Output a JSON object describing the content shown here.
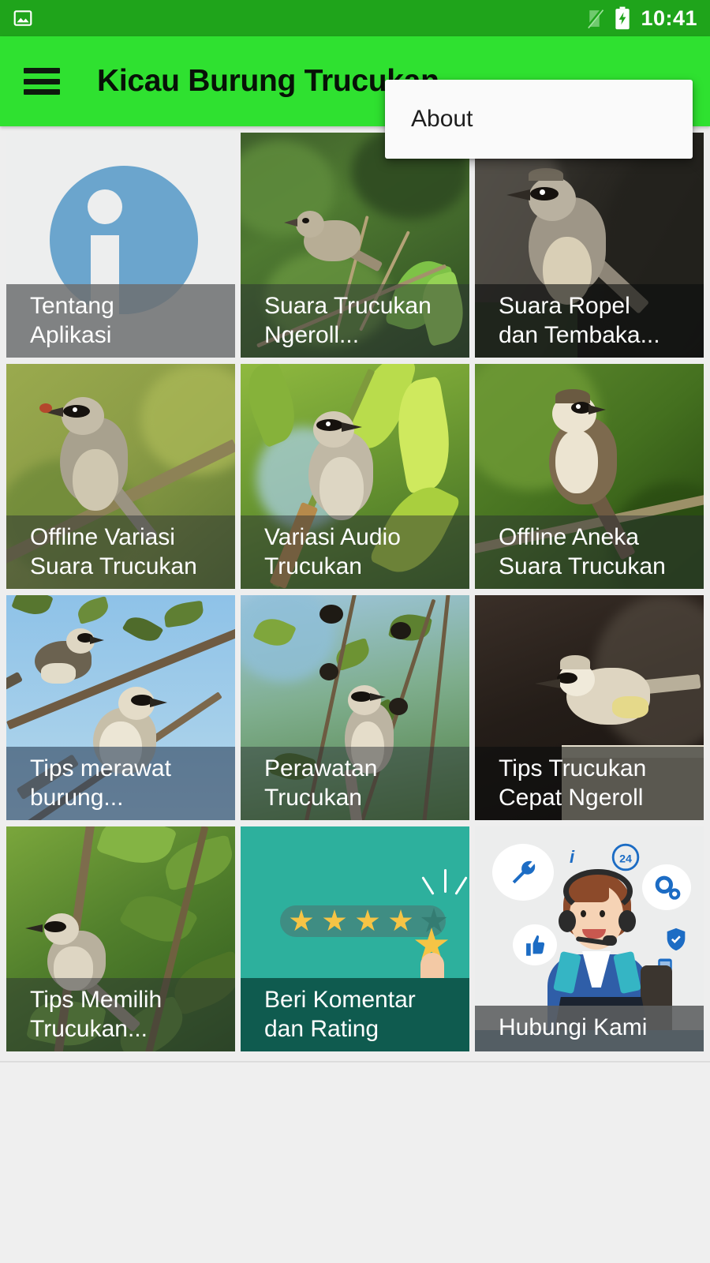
{
  "status_bar": {
    "time": "10:41",
    "icons": [
      "image-icon",
      "signal-off-icon",
      "battery-charging-icon"
    ]
  },
  "app_bar": {
    "menu_icon": "hamburger-menu-icon",
    "title": "Kicau Burung Trucukan",
    "background_color": "#2fe130"
  },
  "overflow_menu": {
    "visible": true,
    "items": [
      {
        "label": "About"
      }
    ]
  },
  "grid": {
    "columns": 3,
    "tiles": [
      {
        "id": "tentang-aplikasi",
        "label_lines": [
          "Tentang",
          "Aplikasi"
        ],
        "caption_style": "light",
        "art": "info"
      },
      {
        "id": "suara-trucukan-ngeroll",
        "label_lines": [
          "Suara Trucukan",
          "Ngeroll..."
        ],
        "caption_style": "plain",
        "art": "bird-green-blur"
      },
      {
        "id": "suara-ropel-dan-tembakan",
        "label_lines": [
          "Suara Ropel",
          "dan Tembaka..."
        ],
        "caption_style": "dark",
        "art": "bird-rock"
      },
      {
        "id": "offline-variasi-suara-trucukan",
        "label_lines": [
          "Offline Variasi",
          "Suara Trucukan"
        ],
        "caption_style": "plain",
        "art": "bird-olive"
      },
      {
        "id": "variasi-audio-trucukan",
        "label_lines": [
          "Variasi Audio",
          "Trucukan"
        ],
        "caption_style": "plain",
        "art": "bird-bamboo"
      },
      {
        "id": "offline-aneka-suara-trucukan",
        "label_lines": [
          "Offline Aneka",
          "Suara Trucukan"
        ],
        "caption_style": "plain",
        "art": "bird-darkgreen"
      },
      {
        "id": "tips-merawat-burung",
        "label_lines": [
          "Tips merawat",
          "burung..."
        ],
        "caption_style": "slate",
        "art": "birds-sky"
      },
      {
        "id": "perawatan-trucukan",
        "label_lines": [
          "Perawatan",
          "Trucukan"
        ],
        "caption_style": "plain",
        "art": "bird-berries"
      },
      {
        "id": "tips-trucukan-cepat-ngeroll",
        "label_lines": [
          "Tips Trucukan",
          "Cepat Ngeroll"
        ],
        "caption_style": "dark",
        "art": "bird-pillar"
      },
      {
        "id": "tips-memilih-trucukan",
        "label_lines": [
          "Tips Memilih",
          "Trucukan..."
        ],
        "caption_style": "plain",
        "art": "bird-foliage"
      },
      {
        "id": "beri-komentar-dan-rating",
        "label_lines": [
          "Beri Komentar",
          "dan Rating"
        ],
        "caption_style": "teal",
        "art": "rating"
      },
      {
        "id": "hubungi-kami",
        "label_lines": [
          "Hubungi Kami"
        ],
        "caption_style": "steel",
        "art": "support"
      }
    ]
  },
  "colors": {
    "status_bar": "#1fa41b",
    "app_bar": "#2fe130",
    "page_background": "#eeeeee",
    "info_icon": "#6ba5cd",
    "rating_background": "#2db09d",
    "star": "#f6c445"
  }
}
